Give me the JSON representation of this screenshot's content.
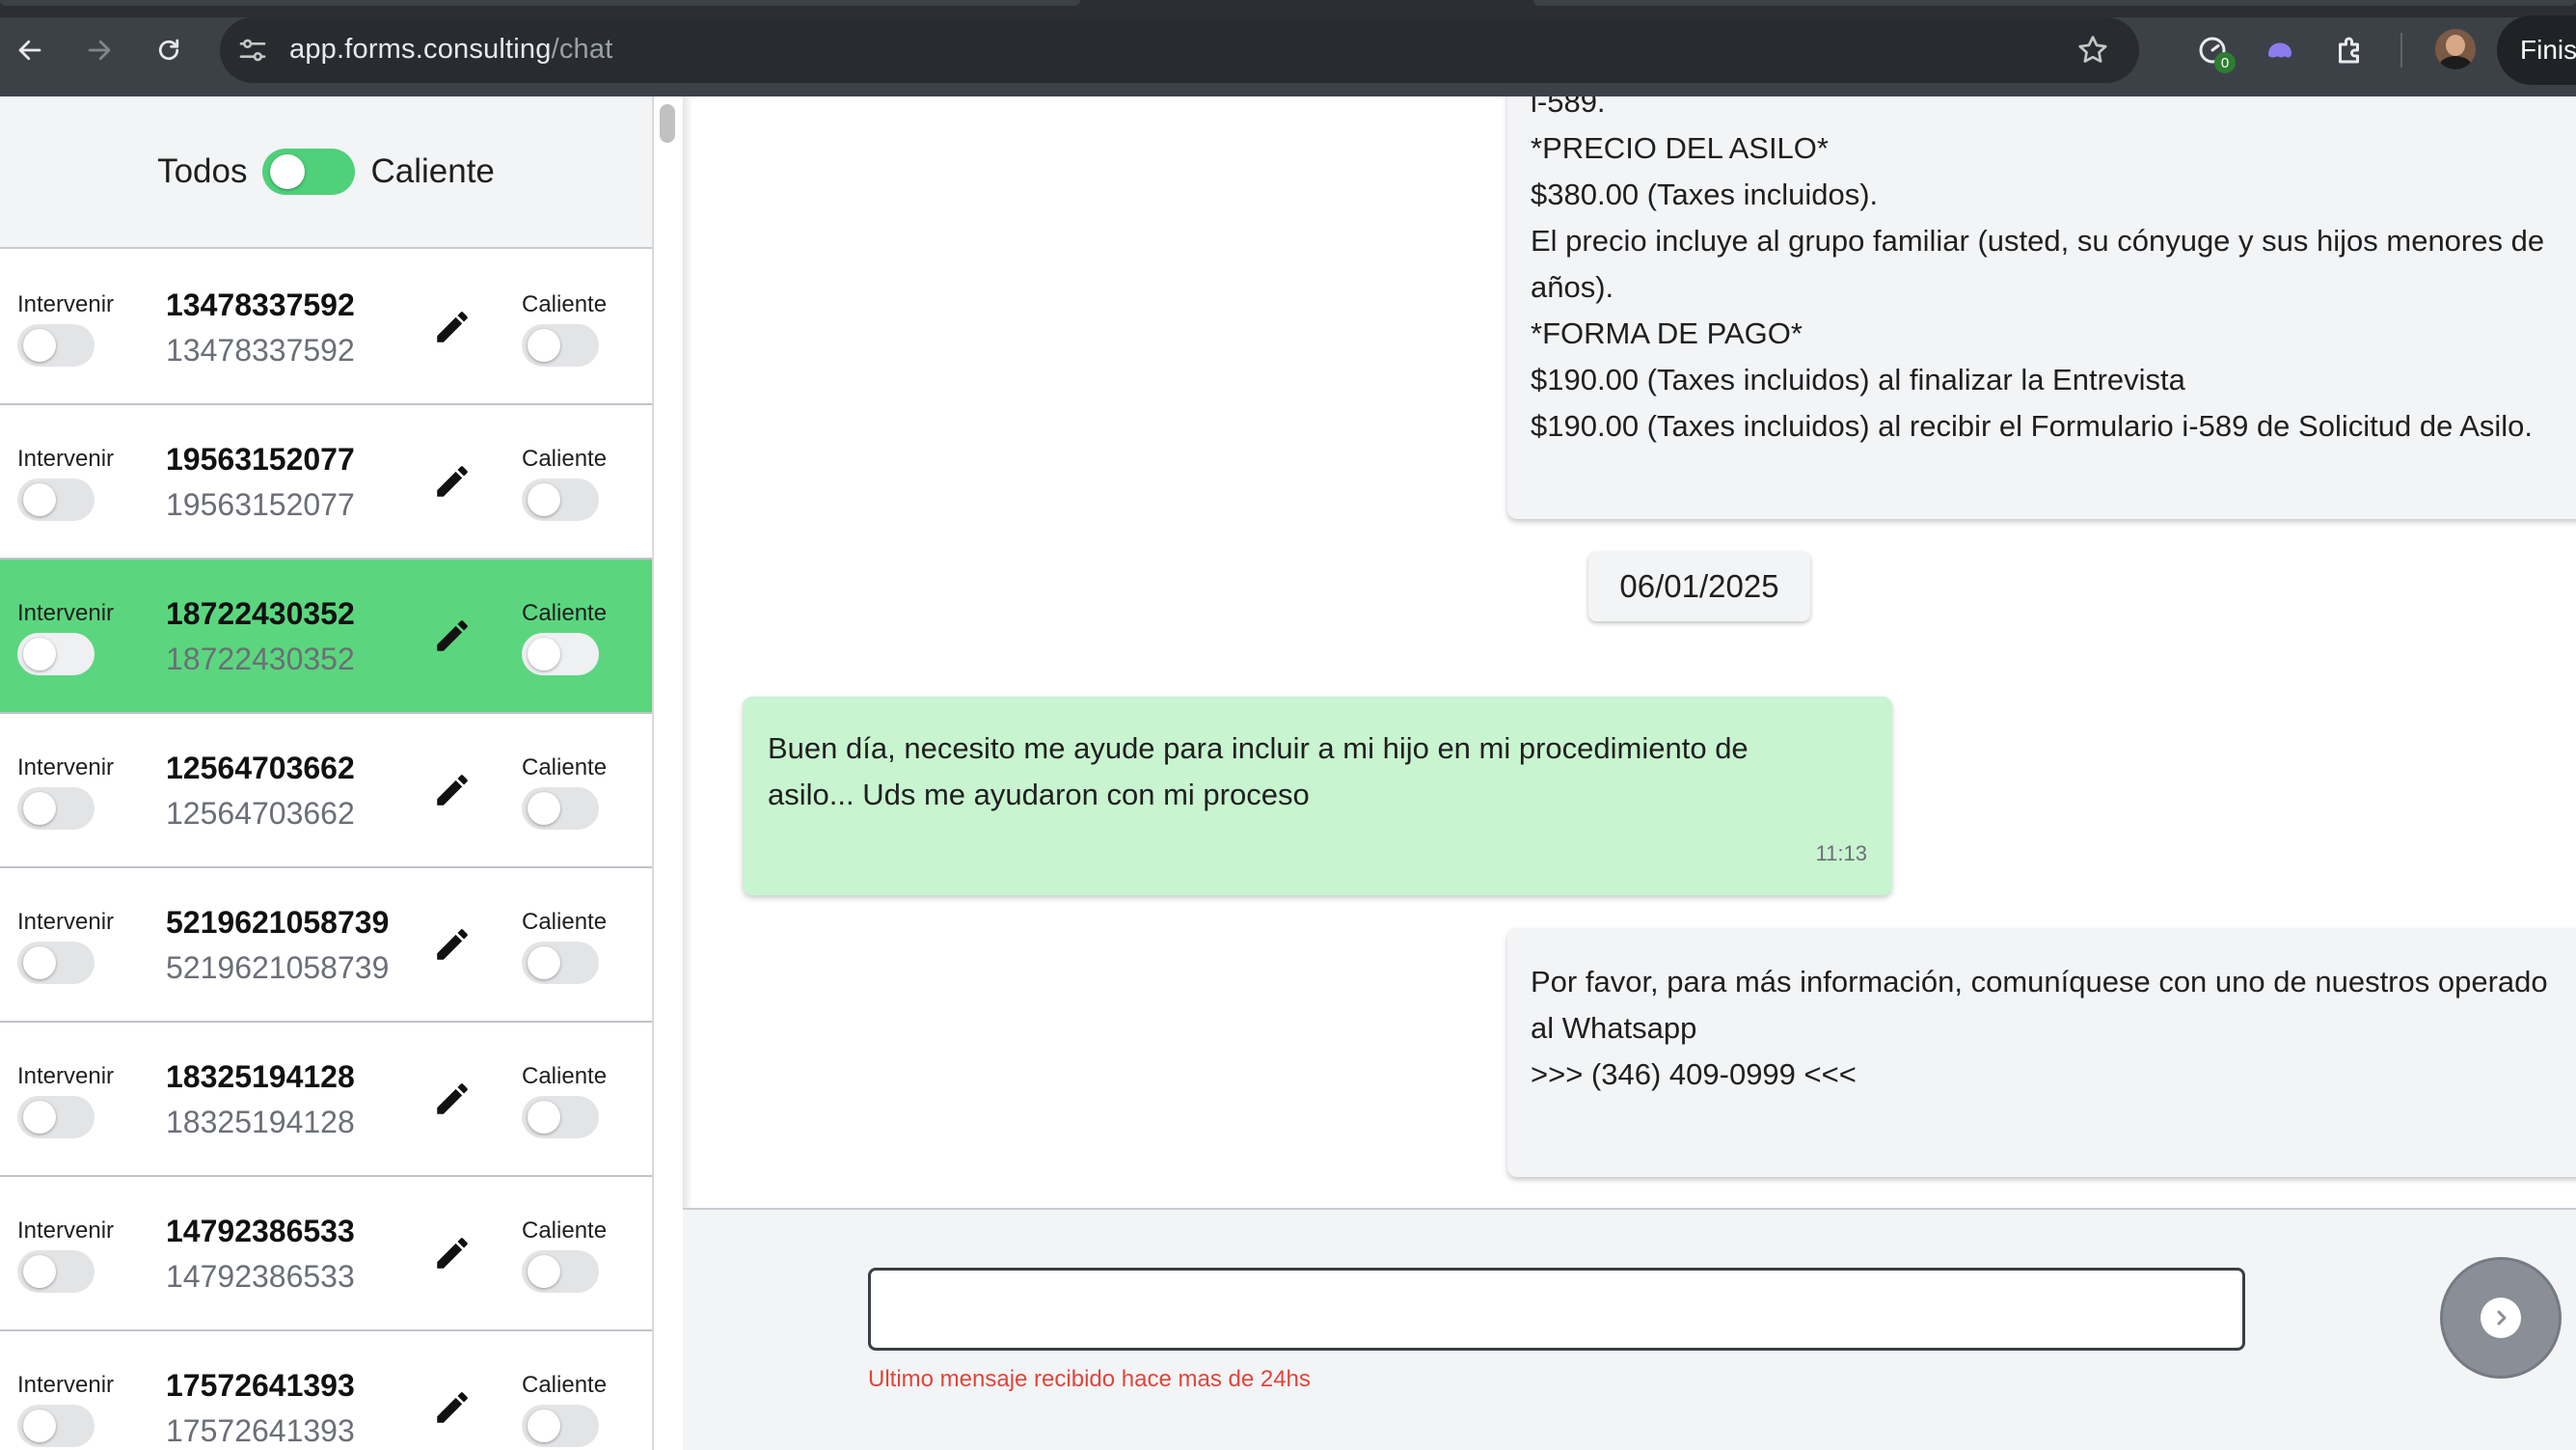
{
  "browser": {
    "url_host": "app.forms.consulting",
    "url_path": "/chat",
    "extension_badge": "0",
    "finish_label": "Finis"
  },
  "sidebar": {
    "filter": {
      "left_label": "Todos",
      "right_label": "Caliente",
      "enabled": true
    },
    "intervene_label": "Intervenir",
    "hot_label": "Caliente",
    "contacts": [
      {
        "phone": "13478337592",
        "subtitle": "13478337592",
        "selected": false
      },
      {
        "phone": "19563152077",
        "subtitle": "19563152077",
        "selected": false
      },
      {
        "phone": "18722430352",
        "subtitle": "18722430352",
        "selected": true
      },
      {
        "phone": "12564703662",
        "subtitle": "12564703662",
        "selected": false
      },
      {
        "phone": "5219621058739",
        "subtitle": "5219621058739",
        "selected": false
      },
      {
        "phone": "18325194128",
        "subtitle": "18325194128",
        "selected": false
      },
      {
        "phone": "14792386533",
        "subtitle": "14792386533",
        "selected": false
      },
      {
        "phone": "17572641393",
        "subtitle": "17572641393",
        "selected": false
      }
    ]
  },
  "chat": {
    "messages_top": {
      "lines": [
        "i-589.",
        "*PRECIO DEL ASILO*",
        "$380.00 (Taxes incluidos).",
        "El precio incluye al grupo familiar (usted, su cónyuge y sus hijos menores de",
        "años).",
        "*FORMA DE PAGO*",
        "$190.00 (Taxes incluidos) al finalizar la Entrevista",
        "$190.00 (Taxes incluidos) al recibir el Formulario i-589 de Solicitud de Asilo."
      ]
    },
    "date_separator": "06/01/2025",
    "incoming": {
      "lines": [
        "Buen día, necesito me ayude para incluir a mi hijo en mi procedimiento de",
        "asilo... Uds me ayudaron con mi proceso"
      ],
      "time": "11:13"
    },
    "outgoing": {
      "lines": [
        "Por favor, para más información, comuníquese con uno de nuestros operado",
        "al Whatsapp",
        ">>> (346) 409-0999 <<<"
      ]
    },
    "composer": {
      "value": "",
      "placeholder": "",
      "warning": "Ultimo mensaje recibido hace mas de 24hs"
    }
  },
  "icons": {
    "back": "back-arrow-icon",
    "forward": "forward-arrow-icon",
    "reload": "reload-icon",
    "site_info": "tune-icon",
    "bookmark": "star-icon",
    "edit": "pencil-icon",
    "send": "chevron-right-icon"
  },
  "colors": {
    "selected_row": "#5bd67e",
    "incoming_bubble": "#c8f4d0",
    "outgoing_bubble": "#f3f4f6",
    "toggle_on": "#4fd07a",
    "warning": "#e0453a"
  }
}
